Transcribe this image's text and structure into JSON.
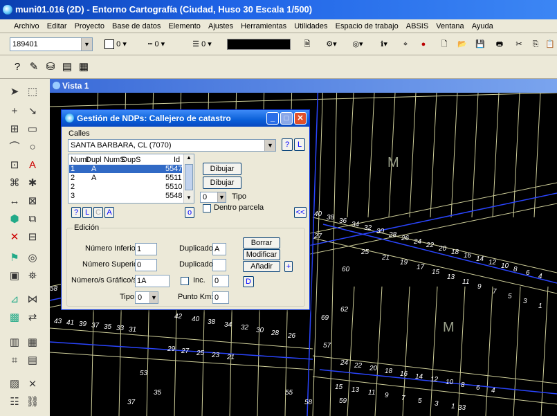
{
  "window": {
    "title": "muni01.016 (2D) - Entorno Cartografía (Ciudad, Huso 30 Escala 1/500)"
  },
  "menu": [
    "Archivo",
    "Editar",
    "Proyecto",
    "Base de datos",
    "Elemento",
    "Ajustes",
    "Herramientas",
    "Utilidades",
    "Espacio de trabajo",
    "ABSIS",
    "Ventana",
    "Ayuda"
  ],
  "toolbar": {
    "level_value": "189401",
    "color_value": "0",
    "style_value": "0",
    "weight_value": "0"
  },
  "view": {
    "title": "Vista 1"
  },
  "map": {
    "labels": [
      "M",
      "M",
      "40",
      "38",
      "36",
      "34",
      "32",
      "30",
      "28",
      "26",
      "24",
      "22",
      "20",
      "18",
      "16",
      "14",
      "12",
      "10",
      "8",
      "6",
      "4",
      "27",
      "25",
      "21",
      "19",
      "17",
      "15",
      "13",
      "11",
      "9",
      "7",
      "5",
      "3",
      "1",
      "58",
      "43",
      "41",
      "39",
      "37",
      "35",
      "33",
      "31",
      "42",
      "40",
      "38",
      "34",
      "32",
      "30",
      "28",
      "26",
      "29",
      "27",
      "25",
      "23",
      "21",
      "24",
      "22",
      "20",
      "18",
      "16",
      "14",
      "12",
      "10",
      "8",
      "6",
      "4",
      "15",
      "13",
      "11",
      "9",
      "7",
      "5",
      "3",
      "1",
      "69",
      "60",
      "62",
      "57",
      "59",
      "58",
      "55",
      "53",
      "37",
      "35",
      "33",
      "24"
    ]
  },
  "dialog": {
    "title": "Gestión de NDPs: Callejero de catastro",
    "calles_label": "Calles",
    "street_value": "SANTA BARBARA, CL (7070)",
    "q_button": "?",
    "l_button": "L",
    "list_headers": [
      "NumI",
      "Dupl",
      "NumS",
      "DupS",
      "Id"
    ],
    "rows": [
      {
        "numi": "1",
        "dupl": "A",
        "id": "5547"
      },
      {
        "numi": "2",
        "dupl": "A",
        "id": "5511"
      },
      {
        "numi": "2",
        "dupl": "",
        "id": "5510"
      },
      {
        "numi": "3",
        "dupl": "",
        "id": "5548"
      }
    ],
    "btn_dibujar_cat": "Dibujar Cat.",
    "btn_dibujar": "Dibujar",
    "tipo_value": "0",
    "tipo_label": "Tipo",
    "dentro_label": "Dentro parcela",
    "small_btns": [
      "?",
      "L",
      "C",
      "A"
    ],
    "o_button": "o",
    "collapse_button": "<<",
    "edicion_label": "Edición",
    "num_inferior_label": "Número Inferior",
    "num_inferior_value": "1",
    "duplicado_label": "Duplicado",
    "dup1_value": "A",
    "dup2_value": "",
    "num_superior_label": "Número Superior",
    "num_superior_value": "0",
    "num_grafico_label": "Número/s Gráfico/s",
    "num_grafico_value": "1A",
    "inc_label": "Inc.",
    "inc_value": "0",
    "tipo2_label": "Tipo",
    "tipo2_value": "0",
    "punto_km_label": "Punto Km:",
    "punto_km_value": "0",
    "btn_borrar": "Borrar",
    "btn_modificar": "Modificar",
    "btn_anadir": "Añadir",
    "plus_button": "+",
    "d_button": "D"
  }
}
